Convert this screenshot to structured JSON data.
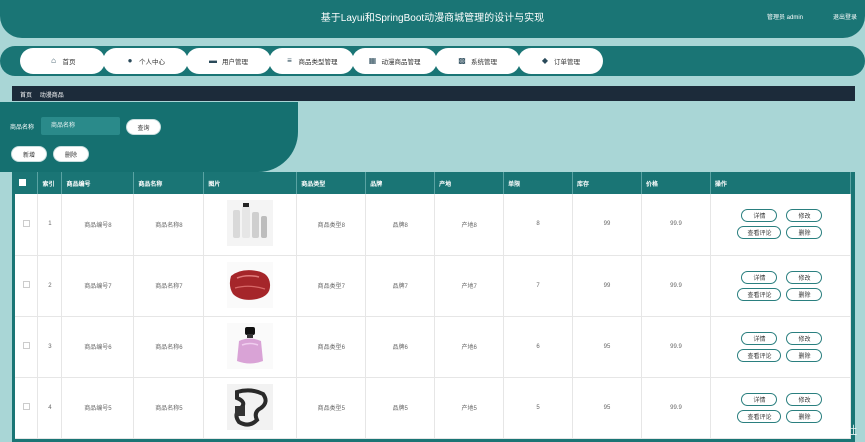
{
  "header": {
    "title": "基于Layui和SpringBoot动漫商城管理的设计与实现",
    "user": "管理员 admin",
    "logout": "退出登录"
  },
  "nav": [
    {
      "label": "首页",
      "icon": "home-icon"
    },
    {
      "label": "个人中心",
      "icon": "user-icon"
    },
    {
      "label": "用户管理",
      "icon": "monitor-icon"
    },
    {
      "label": "商品类型管理",
      "icon": "sliders-icon"
    },
    {
      "label": "动漫商品管理",
      "icon": "calendar-icon"
    },
    {
      "label": "系统管理",
      "icon": "grid-icon"
    },
    {
      "label": "订单管理",
      "icon": "location-icon"
    }
  ],
  "breadcrumb": [
    "首页",
    "动漫商品"
  ],
  "search": {
    "label": "商品名称",
    "placeholder": "商品名称",
    "query": "查询",
    "add": "新增",
    "delete": "删除"
  },
  "table": {
    "columns": [
      "",
      "索引",
      "商品编号",
      "商品名称",
      "图片",
      "商品类型",
      "品牌",
      "产地",
      "单限",
      "库存",
      "价格",
      "操作"
    ],
    "rows": [
      {
        "index": "1",
        "code": "商品编号8",
        "name": "商品名称8",
        "image": "product-image-8",
        "type": "商品类型8",
        "brand": "品牌8",
        "origin": "产地8",
        "limit": "8",
        "stock": "99",
        "price": "99.9"
      },
      {
        "index": "2",
        "code": "商品编号7",
        "name": "商品名称7",
        "image": "product-image-7",
        "type": "商品类型7",
        "brand": "品牌7",
        "origin": "产地7",
        "limit": "7",
        "stock": "99",
        "price": "99.9"
      },
      {
        "index": "3",
        "code": "商品编号6",
        "name": "商品名称6",
        "image": "product-image-6",
        "type": "商品类型6",
        "brand": "品牌6",
        "origin": "产地6",
        "limit": "6",
        "stock": "95",
        "price": "99.9"
      },
      {
        "index": "4",
        "code": "商品编号5",
        "name": "商品名称5",
        "image": "product-image-5",
        "type": "商品类型5",
        "brand": "品牌5",
        "origin": "产地5",
        "limit": "5",
        "stock": "95",
        "price": "99.9"
      }
    ],
    "actions": {
      "detail": "详情",
      "edit": "修改",
      "review": "查看评论",
      "delete": "删除"
    }
  },
  "watermark": "CSDN @优创学社",
  "colors": {
    "primary": "#1a7575",
    "background": "#a9d6d6",
    "breadcrumb": "#1c2b3a"
  }
}
